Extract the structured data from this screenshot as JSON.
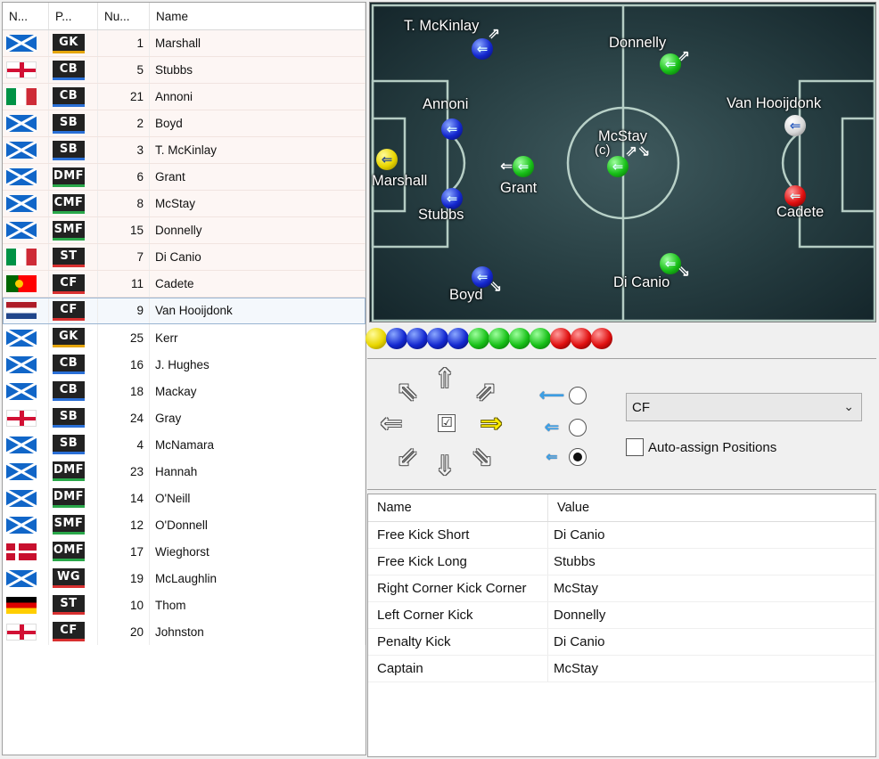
{
  "player_list": {
    "columns": {
      "nationality": "N...",
      "position": "P...",
      "number": "Nu...",
      "name": "Name"
    },
    "rows": [
      {
        "flag": "flag-sco",
        "pos": "GK",
        "pos_color": "pos-gk",
        "number": "1",
        "name": "Marshall",
        "starter": true
      },
      {
        "flag": "flag-eng",
        "pos": "CB",
        "pos_color": "pos-def",
        "number": "5",
        "name": "Stubbs",
        "starter": true
      },
      {
        "flag": "flag-ita",
        "pos": "CB",
        "pos_color": "pos-def",
        "number": "21",
        "name": "Annoni",
        "starter": true
      },
      {
        "flag": "flag-sco",
        "pos": "SB",
        "pos_color": "pos-def",
        "number": "2",
        "name": "Boyd",
        "starter": true
      },
      {
        "flag": "flag-sco",
        "pos": "SB",
        "pos_color": "pos-def",
        "number": "3",
        "name": "T. McKinlay",
        "starter": true
      },
      {
        "flag": "flag-sco",
        "pos": "DMF",
        "pos_color": "pos-mid",
        "number": "6",
        "name": "Grant",
        "starter": true
      },
      {
        "flag": "flag-sco",
        "pos": "CMF",
        "pos_color": "pos-mid",
        "number": "8",
        "name": "McStay",
        "starter": true
      },
      {
        "flag": "flag-sco",
        "pos": "SMF",
        "pos_color": "pos-mid",
        "number": "15",
        "name": "Donnelly",
        "starter": true
      },
      {
        "flag": "flag-ita",
        "pos": "ST",
        "pos_color": "pos-att",
        "number": "7",
        "name": "Di Canio",
        "starter": true
      },
      {
        "flag": "flag-por",
        "pos": "CF",
        "pos_color": "pos-att",
        "number": "11",
        "name": "Cadete",
        "starter": true
      },
      {
        "flag": "flag-ned",
        "pos": "CF",
        "pos_color": "pos-att",
        "number": "9",
        "name": "Van Hooijdonk",
        "starter": true,
        "selected": true
      },
      {
        "flag": "flag-sco",
        "pos": "GK",
        "pos_color": "pos-gk",
        "number": "25",
        "name": "Kerr",
        "starter": false
      },
      {
        "flag": "flag-sco",
        "pos": "CB",
        "pos_color": "pos-def",
        "number": "16",
        "name": "J. Hughes",
        "starter": false
      },
      {
        "flag": "flag-sco",
        "pos": "CB",
        "pos_color": "pos-def",
        "number": "18",
        "name": "Mackay",
        "starter": false
      },
      {
        "flag": "flag-eng",
        "pos": "SB",
        "pos_color": "pos-def",
        "number": "24",
        "name": "Gray",
        "starter": false
      },
      {
        "flag": "flag-sco",
        "pos": "SB",
        "pos_color": "pos-def",
        "number": "4",
        "name": "McNamara",
        "starter": false
      },
      {
        "flag": "flag-sco",
        "pos": "DMF",
        "pos_color": "pos-mid",
        "number": "23",
        "name": "Hannah",
        "starter": false
      },
      {
        "flag": "flag-sco",
        "pos": "DMF",
        "pos_color": "pos-mid",
        "number": "14",
        "name": "O'Neill",
        "starter": false
      },
      {
        "flag": "flag-sco",
        "pos": "SMF",
        "pos_color": "pos-mid",
        "number": "12",
        "name": "O'Donnell",
        "starter": false
      },
      {
        "flag": "flag-den",
        "pos": "OMF",
        "pos_color": "pos-mid",
        "number": "17",
        "name": "Wieghorst",
        "starter": false
      },
      {
        "flag": "flag-sco",
        "pos": "WG",
        "pos_color": "pos-att",
        "number": "19",
        "name": "McLaughlin",
        "starter": false
      },
      {
        "flag": "flag-ger",
        "pos": "ST",
        "pos_color": "pos-att",
        "number": "10",
        "name": "Thom",
        "starter": false
      },
      {
        "flag": "flag-eng",
        "pos": "CF",
        "pos_color": "pos-att",
        "number": "20",
        "name": "Johnston",
        "starter": false
      }
    ]
  },
  "pitch": {
    "players": [
      {
        "name": "Marshall",
        "ball": "ball-yellow",
        "arrow": "⇐",
        "dir": ""
      },
      {
        "name": "Stubbs",
        "ball": "ball-blue",
        "arrow": "⇐",
        "dir": ""
      },
      {
        "name": "Annoni",
        "ball": "ball-blue",
        "arrow": "⇐",
        "dir": ""
      },
      {
        "name": "Boyd",
        "ball": "ball-blue",
        "arrow": "⇐",
        "dir": "⇘"
      },
      {
        "name": "T. McKinlay",
        "ball": "ball-blue",
        "arrow": "⇐",
        "dir": "⇗"
      },
      {
        "name": "Grant",
        "ball": "ball-green",
        "arrow": "⇐",
        "dir": "⇐"
      },
      {
        "name": "(c)",
        "ball": "ball-green",
        "arrow": "⇐",
        "dir": "⇗⇘"
      },
      {
        "name": "McStay",
        "ball": "",
        "arrow": "",
        "dir": ""
      },
      {
        "name": "Donnelly",
        "ball": "ball-green",
        "arrow": "⇐",
        "dir": "⇗"
      },
      {
        "name": "Di Canio",
        "ball": "ball-green",
        "arrow": "⇐",
        "dir": "⇘"
      },
      {
        "name": "Cadete",
        "ball": "ball-red",
        "arrow": "⇐",
        "dir": ""
      },
      {
        "name": "Van Hooijdonk",
        "ball": "ball-white",
        "arrow": "⇐",
        "dir": ""
      }
    ]
  },
  "color_dots": [
    "dot-yellow",
    "dot-blue",
    "dot-blue",
    "dot-blue",
    "dot-blue",
    "dot-green",
    "dot-green",
    "dot-green",
    "dot-green",
    "dot-red",
    "dot-red",
    "dot-red"
  ],
  "controls": {
    "arrows": {
      "up_left": "⇖",
      "up": "⇑",
      "up_right": "⇗",
      "left": "⇐",
      "right": "⇒",
      "down_left": "⇙",
      "down": "⇓",
      "down_right": "⇘",
      "center": "☑"
    },
    "active_direction": "right",
    "speed_options": [
      {
        "icon": "⟵",
        "checked": false
      },
      {
        "icon": "⇐",
        "checked": false
      },
      {
        "icon": "⇐",
        "checked": true
      }
    ],
    "position_value": "CF",
    "position_chevron": "⌄",
    "auto_assign_label": "Auto-assign Positions",
    "auto_assign_checked": false
  },
  "setpieces": {
    "columns": {
      "name": "Name",
      "value": "Value"
    },
    "rows": [
      {
        "name": "Free Kick Short",
        "value": "Di Canio"
      },
      {
        "name": "Free Kick Long",
        "value": "Stubbs"
      },
      {
        "name": "Right Corner Kick Corner",
        "value": "McStay"
      },
      {
        "name": "Left Corner Kick",
        "value": "Donnelly"
      },
      {
        "name": "Penalty Kick",
        "value": "Di Canio"
      },
      {
        "name": "Captain",
        "value": "McStay"
      }
    ]
  }
}
